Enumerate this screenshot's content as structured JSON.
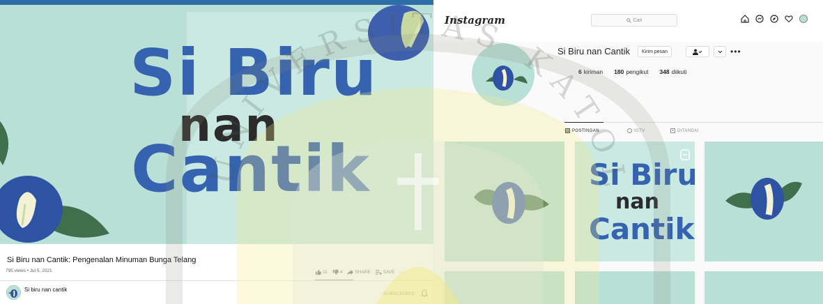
{
  "youtube": {
    "thumbnail": {
      "line1": "Si Biru",
      "line2": "nan",
      "line3": "Cantik"
    },
    "video_title": "Si Biru nan Cantik: Pengenalan Minuman Bunga Telang",
    "meta": "795 views • Jul 5, 2021",
    "actions": {
      "likes": "11",
      "dislikes": "4",
      "share": "SHARE",
      "save": "SAVE",
      "more": "···"
    },
    "channel_name": "Si biru nan cantik",
    "subscribe_label": "SUBSCRIBED"
  },
  "instagram": {
    "logo": "Instagram",
    "search_placeholder": "Cari",
    "username": "Si Biru nan Cantik",
    "message_button": "Kirim pesan",
    "more": "•••",
    "stats": {
      "posts_count": "6",
      "posts_label": "kiriman",
      "followers_count": "180",
      "followers_label": "pengikut",
      "following_count": "348",
      "following_label": "diikuti"
    },
    "tabs": [
      "POSTINGAN",
      "IGTV",
      "DITANDAI"
    ],
    "post_tile": {
      "line1": "Si Biru",
      "line2": "nan",
      "line3": "Cantik"
    }
  },
  "watermark": {
    "text": "UNIVERSITAS KATOLIK"
  },
  "colors": {
    "background_teal": "#b9e0d7",
    "brand_blue": "#3563b0",
    "dark_text": "#2b2b2b",
    "leaf_green": "#3f6f4d",
    "watermark_yellow": "#f3e98a"
  }
}
